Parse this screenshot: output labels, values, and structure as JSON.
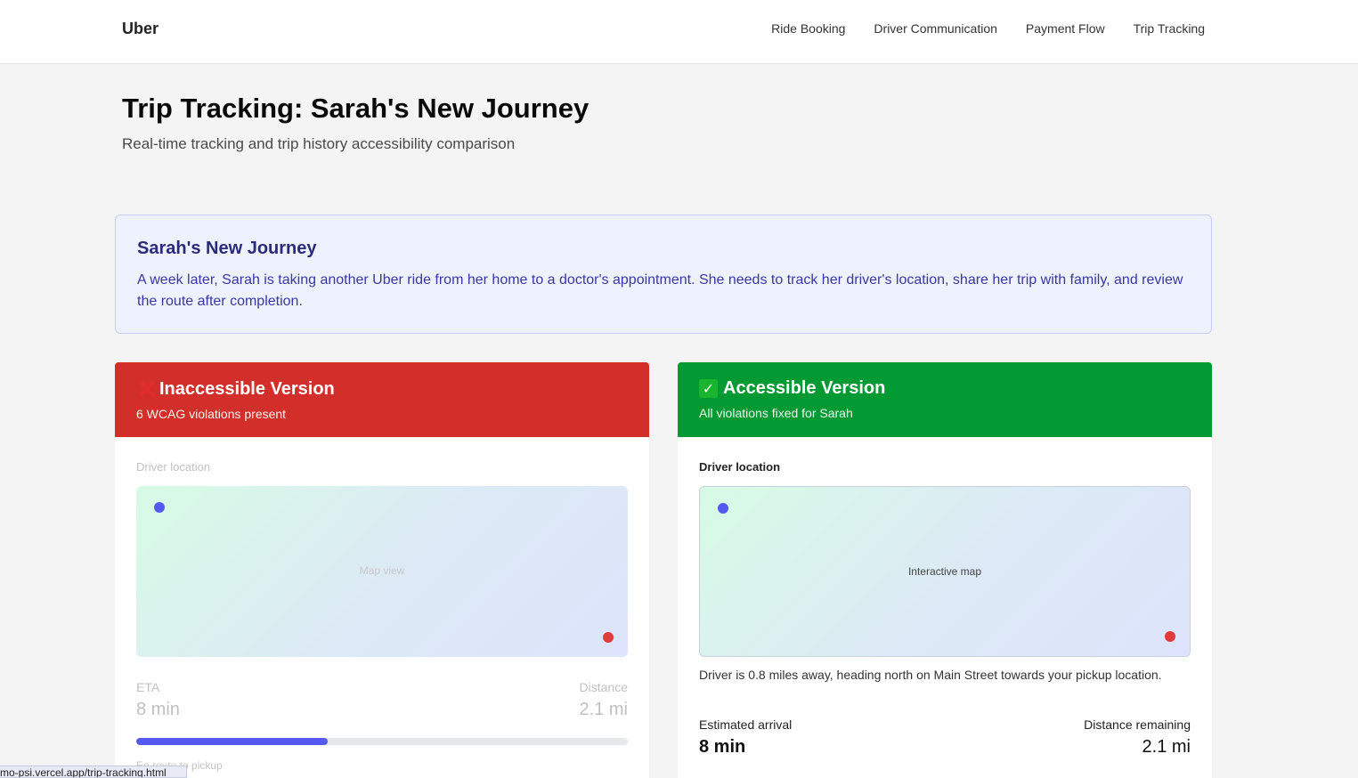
{
  "header": {
    "brand": "Uber",
    "nav": [
      "Ride Booking",
      "Driver Communication",
      "Payment Flow",
      "Trip Tracking"
    ]
  },
  "page": {
    "title": "Trip Tracking: Sarah's New Journey",
    "subtitle": "Real-time tracking and trip history accessibility comparison"
  },
  "story": {
    "title": "Sarah's New Journey",
    "text": "A week later, Sarah is taking another Uber ride from her home to a doctor's appointment. She needs to track her driver's location, share her trip with family, and review the route after completion."
  },
  "inaccessible": {
    "icon": "cross-mark-icon",
    "title": "Inaccessible Version",
    "subtitle": "6 WCAG violations present",
    "location_label": "Driver location",
    "map_label": "Map view",
    "eta_label": "ETA",
    "eta_value": "8 min",
    "distance_label": "Distance",
    "distance_value": "2.1 mi",
    "progress_percent": 39,
    "progress_label": "En route to pickup",
    "accent": "#d32f2a"
  },
  "accessible": {
    "icon": "check-mark-icon",
    "title": "Accessible Version",
    "subtitle": "All violations fixed for Sarah",
    "location_label": "Driver location",
    "map_label": "Interactive map",
    "description": "Driver is 0.8 miles away, heading north on Main Street towards your pickup location.",
    "eta_label": "Estimated arrival",
    "eta_value": "8 min",
    "distance_label": "Distance remaining",
    "distance_value": "2.1 mi",
    "accent": "#049a33"
  },
  "statusbar": {
    "url": "mo-psi.vercel.app/trip-tracking.html"
  }
}
